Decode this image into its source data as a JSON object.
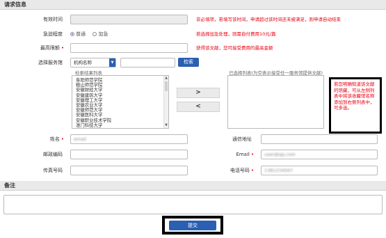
{
  "request_info": {
    "section_title": "请求信息",
    "valid_time": {
      "label": "有效时间",
      "value": "",
      "hint": "非必填项，若填写该时间，申请超过该时间还未被满足，则申请自动结束"
    },
    "urgency": {
      "label": "急迫程度",
      "options": [
        "普通",
        "加急"
      ],
      "selected": "普通",
      "hint": "若选择加急处理，则需自付费用10元/篇"
    },
    "max_amount": {
      "label": "最高限额",
      "value": "",
      "hint": "获得该文献，您可接受费用的最高金额"
    },
    "service_library": {
      "label": "选择服务馆",
      "filter_select": "机构名称",
      "search_value": "",
      "search_button": "检索",
      "results_label": "检索结果列表",
      "results": [
        "阜阳师范学院",
        "鞍山师范学院",
        "安徽财经大学",
        "安徽建筑大学",
        "安徽理工大学",
        "安徽农业大学",
        "安徽师范大学",
        "安徽医科大学",
        "安徽职业技术学院",
        "淮门科技大学",
        "白城师范学院",
        "白城医学高等专科学校"
      ],
      "add_button": ">",
      "remove_button": "<",
      "selected_label": "已选择列表(为空表示接受任一服务馆提供文献)",
      "selected": []
    },
    "callout": "若您明确知道该文献的馆藏，可从左侧列表中将该收藏馆名称添加到右侧列表中，可多选。"
  },
  "contact": {
    "name": {
      "label": "姓名",
      "value": "email"
    },
    "address": {
      "label": "通信地址",
      "value": ""
    },
    "postcode": {
      "label": "邮政编码",
      "value": ""
    },
    "email": {
      "label": "Email",
      "value": "user@qq.com"
    },
    "fax": {
      "label": "传真号码",
      "value": ""
    },
    "phone": {
      "label": "电话号码",
      "value": "1381234567"
    }
  },
  "remarks": {
    "section_title": "备注",
    "value": ""
  },
  "submit_label": "提交",
  "colors": {
    "required": "#e60012",
    "accent": "#2a5fb2",
    "header_bg": "#e9e9e9"
  }
}
